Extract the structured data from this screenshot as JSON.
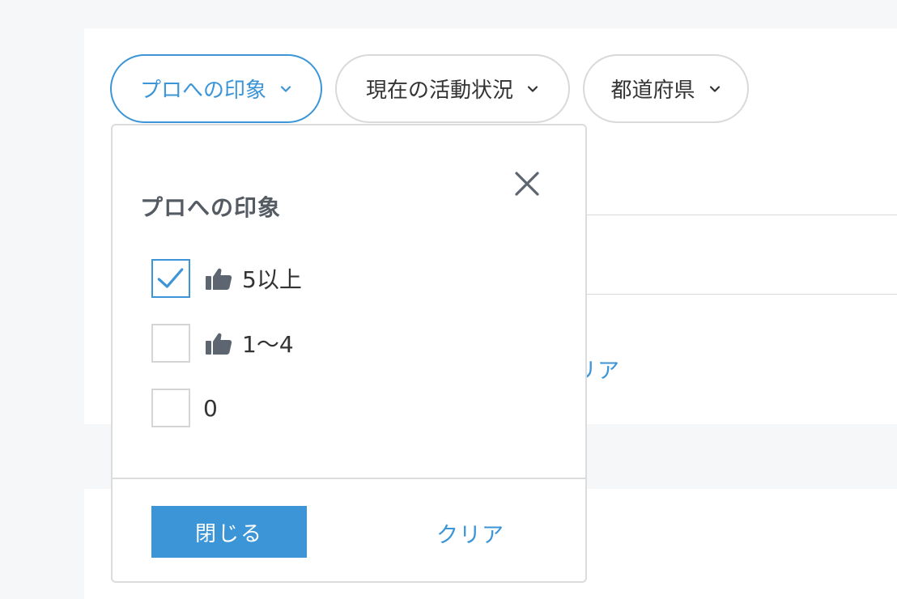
{
  "filters": {
    "chips": [
      {
        "label": "プロへの印象",
        "active": true
      },
      {
        "label": "現在の活動状況",
        "active": false
      },
      {
        "label": "都道府県",
        "active": false
      }
    ]
  },
  "background": {
    "clear_partial": "リア"
  },
  "panel": {
    "title": "プロへの印象",
    "options": [
      {
        "label": "5以上",
        "checked": true,
        "icon": "thumbs-up-icon"
      },
      {
        "label": "1〜4",
        "checked": false,
        "icon": "thumbs-up-icon"
      },
      {
        "label": "0",
        "checked": false,
        "icon": null
      }
    ],
    "close_label": "閉じる",
    "clear_label": "クリア"
  },
  "colors": {
    "accent": "#3b95d7",
    "icon_gray": "#5d6670",
    "border": "#d9d9d9"
  }
}
